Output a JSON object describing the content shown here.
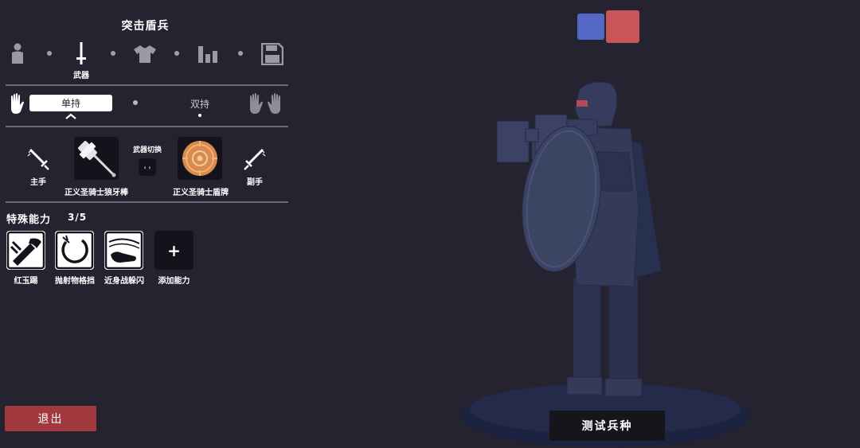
{
  "unit": {
    "title": "突击盾兵"
  },
  "steps": [
    {
      "icon": "person-icon",
      "caption": ""
    },
    {
      "icon": "sword-icon",
      "caption": "武器"
    },
    {
      "icon": "shirt-icon",
      "caption": ""
    },
    {
      "icon": "bar-chart-icon",
      "caption": ""
    },
    {
      "icon": "save-icon",
      "caption": ""
    }
  ],
  "grip": {
    "selected": "单持",
    "other": "双持"
  },
  "weapons": {
    "main_hand_label": "主手",
    "off_hand_label": "副手",
    "switch_label": "武器切换",
    "switch_symbol": "‹ ›",
    "main_weapon": "正义圣骑士狼牙棒",
    "off_weapon": "正义圣骑士盾牌"
  },
  "abilities": {
    "header": "特殊能力",
    "count": "3/5",
    "items": [
      {
        "label": "红玉踢",
        "icon": "kick-icon"
      },
      {
        "label": "抛射物格挡",
        "icon": "projectile-block-icon"
      },
      {
        "label": "近身战躲闪",
        "icon": "melee-dodge-icon"
      }
    ],
    "add_label": "添加能力",
    "add_symbol": "+"
  },
  "exit_label": "退出",
  "test_label": "测试兵种",
  "colors": {
    "background": "#24232f",
    "team_blue": "#5368c4",
    "team_red": "#c95656",
    "exit_button": "#a1383e",
    "unit_body": "#2f3552"
  }
}
